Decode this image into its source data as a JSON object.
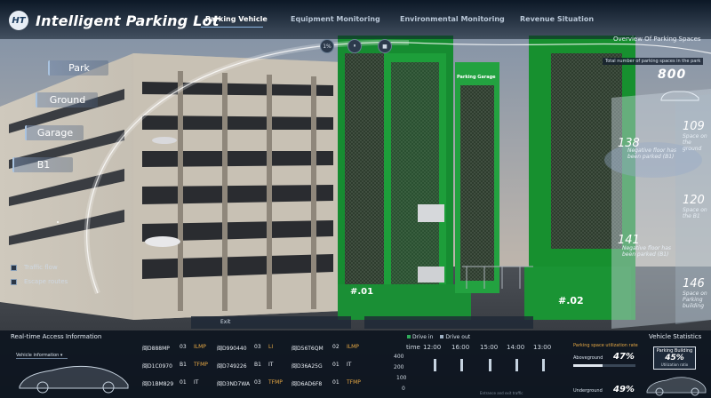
{
  "app": {
    "title": "Intelligent Parking Lot",
    "logo_text": "HT"
  },
  "tabs": [
    {
      "label": "Parking Vehicle",
      "active": true
    },
    {
      "label": "Equipment Monitoring",
      "active": false
    },
    {
      "label": "Environmental Monitoring",
      "active": false
    },
    {
      "label": "Revenue Situation",
      "active": false
    }
  ],
  "view_buttons": [
    "1%",
    "",
    ""
  ],
  "side_menu": [
    "Park",
    "Ground",
    "Garage",
    "B1"
  ],
  "layers": [
    "Traffic flow",
    "Escape routes"
  ],
  "overview": {
    "title": "Overview Of Parking Spaces",
    "total_label": "Total number of parking spaces in the park",
    "total": "800",
    "neg_floor_label": "Negative floor has been parked (B1)",
    "neg_floor_value": "138",
    "neg_floor2_label": "Negative floor has been parked (B1)",
    "neg_floor2_value": "141",
    "ground_label": "Space on the ground",
    "ground_value": "109",
    "b1_label": "Space on the B1",
    "b1_value": "120",
    "building_label": "Space on Parking building",
    "building_value": "146"
  },
  "scene": {
    "tower_sign": "Parking Garage",
    "tower1_label": "#.01",
    "tower2_label": "#.02",
    "ground_signs": [
      "Exit",
      "",
      "",
      ""
    ]
  },
  "access": {
    "title": "Real-time Access Information",
    "vehicle_info": "Vehicle information",
    "rows": [
      {
        "c1": [
          "闽D888MP",
          "03",
          "ILMP"
        ],
        "c2": [
          "闽D990440",
          "03",
          "LI"
        ],
        "c3": [
          "闽D56T6QM",
          "02",
          "ILMP"
        ]
      },
      {
        "c1": [
          "闽D1C0970",
          "B1",
          "TFMP"
        ],
        "c2": [
          "闽D749226",
          "B1",
          "IT"
        ],
        "c3": [
          "闽D36A25G",
          "01",
          "IT"
        ]
      },
      {
        "c1": [
          "闽D1BM829",
          "01",
          "IT"
        ],
        "c2": [
          "闽D3ND7WA",
          "03",
          "TFMP"
        ],
        "c3": [
          "闽D6AD6F8",
          "01",
          "TFMP"
        ]
      }
    ]
  },
  "traffic": {
    "legend": [
      "Drive in",
      "Drive out"
    ],
    "y_ticks": [
      "400",
      "200",
      "100",
      "0"
    ],
    "x_label": "time",
    "x_ticks": [
      "12:00",
      "16:00",
      "15:00",
      "14:00",
      "13:00"
    ],
    "footnote": "Entrance and exit traffic"
  },
  "utilization": {
    "title": "Parking space utilization rate",
    "above_label": "Aboveground",
    "above_value": "47%",
    "above_fraction": 0.47,
    "under_label": "Underground",
    "under_value": "49%",
    "under_fraction": 0.49
  },
  "stats": {
    "title": "Vehicle Statistics",
    "card_label": "Parking Building",
    "card_value": "45%",
    "card_sub": "Utilization ratio"
  },
  "colors": {
    "accent": "#e7a944",
    "tower_green": "#1f9a3a",
    "panel": "#0e1620"
  }
}
